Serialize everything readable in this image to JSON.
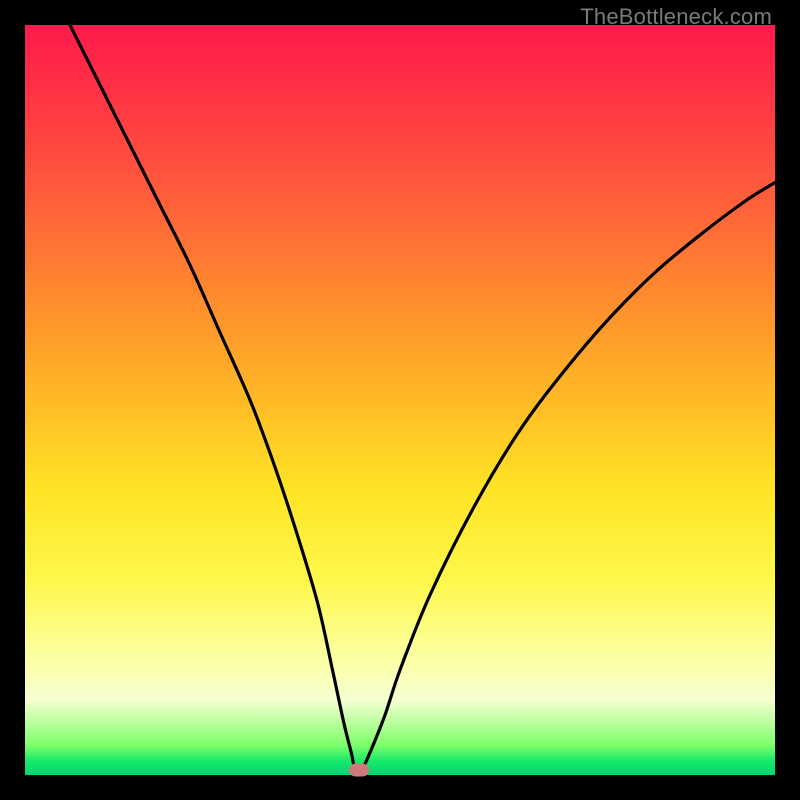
{
  "watermark": "TheBottleneck.com",
  "chart_data": {
    "type": "line",
    "title": "",
    "xlabel": "",
    "ylabel": "",
    "xlim": [
      0,
      100
    ],
    "ylim": [
      0,
      100
    ],
    "grid": false,
    "series": [
      {
        "name": "bottleneck-curve",
        "x": [
          6,
          10,
          14,
          18,
          22,
          26,
          30,
          33,
          36,
          39,
          41,
          42.5,
          43.5,
          44,
          45,
          46,
          48,
          50,
          54,
          60,
          66,
          72,
          78,
          84,
          90,
          96,
          100
        ],
        "values": [
          100,
          92,
          84,
          76,
          68,
          59,
          50,
          42,
          33,
          23,
          14,
          7,
          3,
          1,
          1,
          3,
          8,
          14,
          24,
          36,
          46,
          54,
          61,
          67,
          72,
          76.5,
          79
        ]
      }
    ],
    "marker": {
      "x": 44.5,
      "y": 0.7,
      "color": "#cf7a7a"
    },
    "gradient_stops": [
      {
        "pos": 0,
        "color": "#ff1a4b"
      },
      {
        "pos": 0.22,
        "color": "#ff5a3c"
      },
      {
        "pos": 0.48,
        "color": "#ffb326"
      },
      {
        "pos": 0.74,
        "color": "#fff84a"
      },
      {
        "pos": 0.9,
        "color": "#f6ffd0"
      },
      {
        "pos": 0.98,
        "color": "#17e86b"
      },
      {
        "pos": 1.0,
        "color": "#00d574"
      }
    ]
  }
}
